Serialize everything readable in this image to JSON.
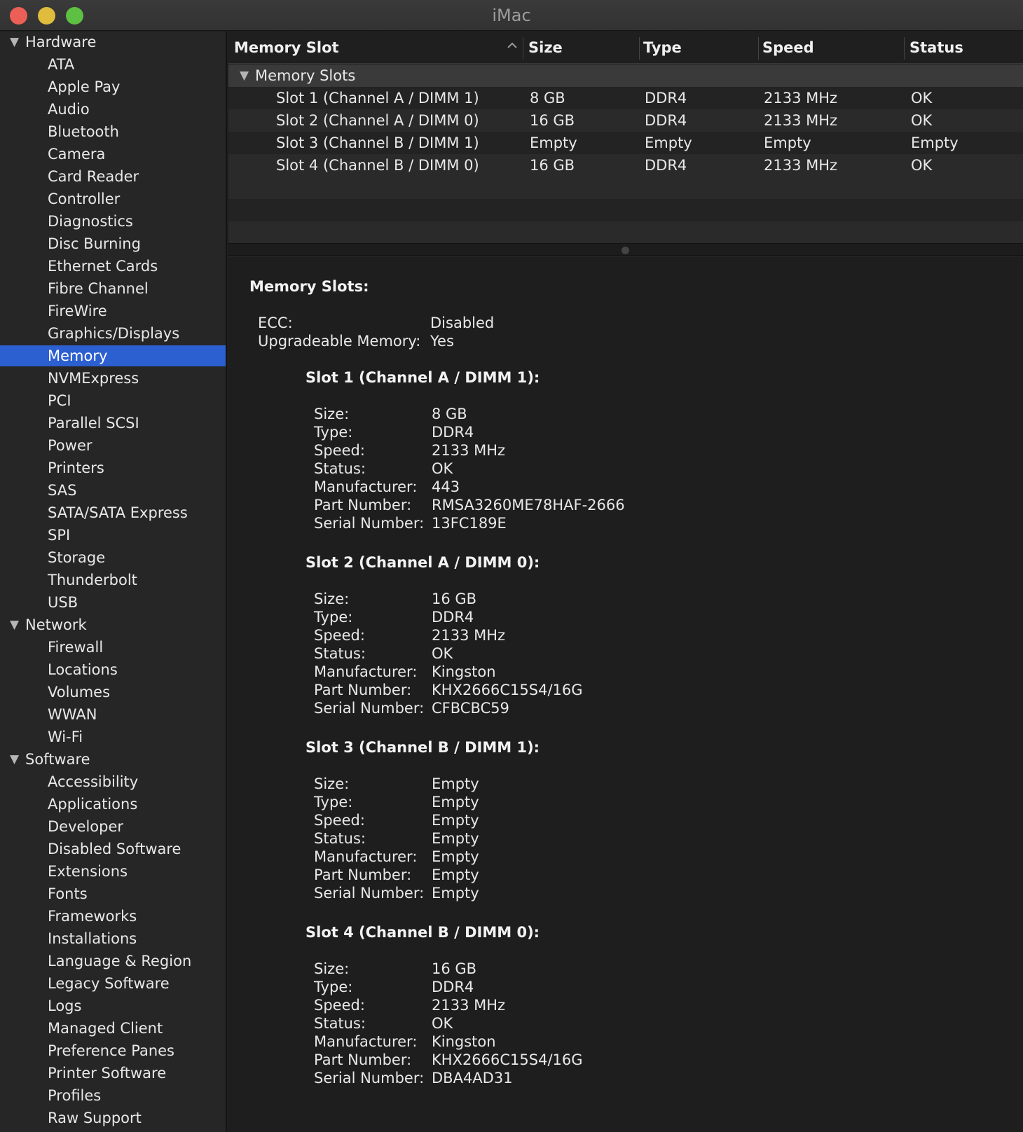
{
  "window": {
    "title": "iMac"
  },
  "sidebar": {
    "items": [
      {
        "label": "Hardware",
        "kind": "group"
      },
      {
        "label": "ATA",
        "kind": "item"
      },
      {
        "label": "Apple Pay",
        "kind": "item"
      },
      {
        "label": "Audio",
        "kind": "item"
      },
      {
        "label": "Bluetooth",
        "kind": "item"
      },
      {
        "label": "Camera",
        "kind": "item"
      },
      {
        "label": "Card Reader",
        "kind": "item"
      },
      {
        "label": "Controller",
        "kind": "item"
      },
      {
        "label": "Diagnostics",
        "kind": "item"
      },
      {
        "label": "Disc Burning",
        "kind": "item"
      },
      {
        "label": "Ethernet Cards",
        "kind": "item"
      },
      {
        "label": "Fibre Channel",
        "kind": "item"
      },
      {
        "label": "FireWire",
        "kind": "item"
      },
      {
        "label": "Graphics/Displays",
        "kind": "item"
      },
      {
        "label": "Memory",
        "kind": "item",
        "selected": true
      },
      {
        "label": "NVMExpress",
        "kind": "item"
      },
      {
        "label": "PCI",
        "kind": "item"
      },
      {
        "label": "Parallel SCSI",
        "kind": "item"
      },
      {
        "label": "Power",
        "kind": "item"
      },
      {
        "label": "Printers",
        "kind": "item"
      },
      {
        "label": "SAS",
        "kind": "item"
      },
      {
        "label": "SATA/SATA Express",
        "kind": "item"
      },
      {
        "label": "SPI",
        "kind": "item"
      },
      {
        "label": "Storage",
        "kind": "item"
      },
      {
        "label": "Thunderbolt",
        "kind": "item"
      },
      {
        "label": "USB",
        "kind": "item"
      },
      {
        "label": "Network",
        "kind": "group"
      },
      {
        "label": "Firewall",
        "kind": "item"
      },
      {
        "label": "Locations",
        "kind": "item"
      },
      {
        "label": "Volumes",
        "kind": "item"
      },
      {
        "label": "WWAN",
        "kind": "item"
      },
      {
        "label": "Wi-Fi",
        "kind": "item"
      },
      {
        "label": "Software",
        "kind": "group"
      },
      {
        "label": "Accessibility",
        "kind": "item"
      },
      {
        "label": "Applications",
        "kind": "item"
      },
      {
        "label": "Developer",
        "kind": "item"
      },
      {
        "label": "Disabled Software",
        "kind": "item"
      },
      {
        "label": "Extensions",
        "kind": "item"
      },
      {
        "label": "Fonts",
        "kind": "item"
      },
      {
        "label": "Frameworks",
        "kind": "item"
      },
      {
        "label": "Installations",
        "kind": "item"
      },
      {
        "label": "Language & Region",
        "kind": "item"
      },
      {
        "label": "Legacy Software",
        "kind": "item"
      },
      {
        "label": "Logs",
        "kind": "item"
      },
      {
        "label": "Managed Client",
        "kind": "item"
      },
      {
        "label": "Preference Panes",
        "kind": "item"
      },
      {
        "label": "Printer Software",
        "kind": "item"
      },
      {
        "label": "Profiles",
        "kind": "item"
      },
      {
        "label": "Raw Support",
        "kind": "item"
      }
    ]
  },
  "table": {
    "columns": [
      "Memory Slot",
      "Size",
      "Type",
      "Speed",
      "Status"
    ],
    "sort_column": "Memory Slot",
    "group_label": "Memory Slots",
    "rows": [
      [
        "Slot 1 (Channel A / DIMM 1)",
        "8 GB",
        "DDR4",
        "2133 MHz",
        "OK"
      ],
      [
        "Slot 2 (Channel A / DIMM 0)",
        "16 GB",
        "DDR4",
        "2133 MHz",
        "OK"
      ],
      [
        "Slot 3 (Channel B / DIMM 1)",
        "Empty",
        "Empty",
        "Empty",
        "Empty"
      ],
      [
        "Slot 4 (Channel B / DIMM 0)",
        "16 GB",
        "DDR4",
        "2133 MHz",
        "OK"
      ]
    ]
  },
  "detail": {
    "heading": "Memory Slots:",
    "summary": [
      {
        "key": "ECC:",
        "value": "Disabled"
      },
      {
        "key": "Upgradeable Memory:",
        "value": "Yes"
      }
    ],
    "slots": [
      {
        "title": "Slot 1 (Channel A / DIMM 1):",
        "fields": [
          {
            "key": "Size:",
            "value": "8 GB"
          },
          {
            "key": "Type:",
            "value": "DDR4"
          },
          {
            "key": "Speed:",
            "value": "2133 MHz"
          },
          {
            "key": "Status:",
            "value": "OK"
          },
          {
            "key": "Manufacturer:",
            "value": "443"
          },
          {
            "key": "Part Number:",
            "value": "RMSA3260ME78HAF-2666"
          },
          {
            "key": "Serial Number:",
            "value": "13FC189E"
          }
        ]
      },
      {
        "title": "Slot 2 (Channel A / DIMM 0):",
        "fields": [
          {
            "key": "Size:",
            "value": "16 GB"
          },
          {
            "key": "Type:",
            "value": "DDR4"
          },
          {
            "key": "Speed:",
            "value": "2133 MHz"
          },
          {
            "key": "Status:",
            "value": "OK"
          },
          {
            "key": "Manufacturer:",
            "value": "Kingston"
          },
          {
            "key": "Part Number:",
            "value": "KHX2666C15S4/16G"
          },
          {
            "key": "Serial Number:",
            "value": "CFBCBC59"
          }
        ]
      },
      {
        "title": "Slot 3 (Channel B / DIMM 1):",
        "fields": [
          {
            "key": "Size:",
            "value": "Empty"
          },
          {
            "key": "Type:",
            "value": "Empty"
          },
          {
            "key": "Speed:",
            "value": "Empty"
          },
          {
            "key": "Status:",
            "value": "Empty"
          },
          {
            "key": "Manufacturer:",
            "value": "Empty"
          },
          {
            "key": "Part Number:",
            "value": "Empty"
          },
          {
            "key": "Serial Number:",
            "value": "Empty"
          }
        ]
      },
      {
        "title": "Slot 4 (Channel B / DIMM 0):",
        "fields": [
          {
            "key": "Size:",
            "value": "16 GB"
          },
          {
            "key": "Type:",
            "value": "DDR4"
          },
          {
            "key": "Speed:",
            "value": "2133 MHz"
          },
          {
            "key": "Status:",
            "value": "OK"
          },
          {
            "key": "Manufacturer:",
            "value": "Kingston"
          },
          {
            "key": "Part Number:",
            "value": "KHX2666C15S4/16G"
          },
          {
            "key": "Serial Number:",
            "value": "DBA4AD31"
          }
        ]
      }
    ]
  },
  "colors": {
    "selection": "#2c5fd0",
    "close": "#ec5f57",
    "minimize": "#e0bc3c",
    "maximize": "#5dc042"
  }
}
